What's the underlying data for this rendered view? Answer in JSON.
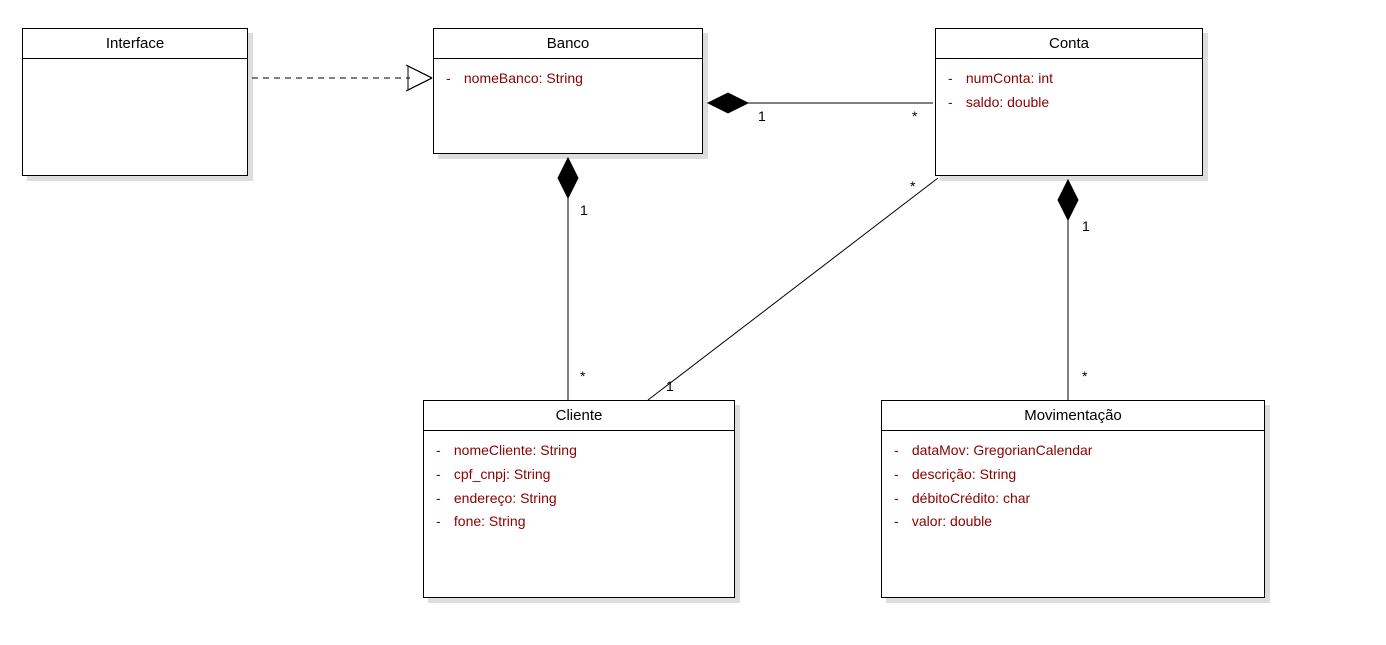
{
  "diagram": {
    "type": "uml_class_diagram",
    "classes": {
      "interface": {
        "name": "Interface",
        "attributes": []
      },
      "banco": {
        "name": "Banco",
        "attributes": [
          {
            "visibility": "-",
            "name": "nomeBanco",
            "type": "String"
          }
        ]
      },
      "conta": {
        "name": "Conta",
        "attributes": [
          {
            "visibility": "-",
            "name": "numConta",
            "type": "int"
          },
          {
            "visibility": "-",
            "name": "saldo",
            "type": "double"
          }
        ]
      },
      "cliente": {
        "name": "Cliente",
        "attributes": [
          {
            "visibility": "-",
            "name": "nomeCliente",
            "type": "String"
          },
          {
            "visibility": "-",
            "name": "cpf_cnpj",
            "type": "String"
          },
          {
            "visibility": "-",
            "name": "endereço",
            "type": "String"
          },
          {
            "visibility": "-",
            "name": "fone",
            "type": "String"
          }
        ]
      },
      "movimentacao": {
        "name": "Movimentação",
        "attributes": [
          {
            "visibility": "-",
            "name": "dataMov",
            "type": "GregorianCalendar"
          },
          {
            "visibility": "-",
            "name": "descrição",
            "type": "String"
          },
          {
            "visibility": "-",
            "name": "débitoCrédito",
            "type": "char"
          },
          {
            "visibility": "-",
            "name": "valor",
            "type": "double"
          }
        ]
      }
    },
    "relationships": [
      {
        "from": "interface",
        "to": "banco",
        "type": "dependency"
      },
      {
        "from": "banco",
        "to": "conta",
        "type": "composition",
        "from_mult": "1",
        "to_mult": "*"
      },
      {
        "from": "banco",
        "to": "cliente",
        "type": "composition",
        "from_mult": "1",
        "to_mult": "*"
      },
      {
        "from": "conta",
        "to": "movimentacao",
        "type": "composition",
        "from_mult": "1",
        "to_mult": "*"
      },
      {
        "from": "cliente",
        "to": "conta",
        "type": "association",
        "from_mult": "1",
        "to_mult": "*"
      }
    ],
    "multiplicities": {
      "banco_conta_banco": "1",
      "banco_conta_conta": "*",
      "banco_cliente_banco": "1",
      "banco_cliente_cliente": "*",
      "conta_mov_conta": "1",
      "conta_mov_mov": "*",
      "cliente_conta_cliente": "1",
      "cliente_conta_conta": "*"
    }
  }
}
